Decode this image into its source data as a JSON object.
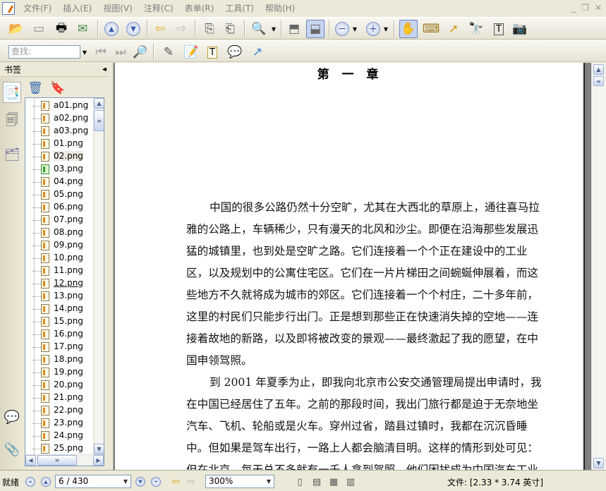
{
  "menu": {
    "items": [
      "文件(F)",
      "插入(E)",
      "视图(V)",
      "注释(C)",
      "表单(R)",
      "工具(T)",
      "帮助(H)"
    ]
  },
  "search": {
    "placeholder": "查找:"
  },
  "sidebar": {
    "title": "书签",
    "collapse_glyph": "◂◂",
    "items": [
      "a01.png",
      "a02.png",
      "a03.png",
      "01.png",
      "02.png",
      "03.png",
      "04.png",
      "05.png",
      "06.png",
      "07.png",
      "08.png",
      "09.png",
      "10.png",
      "11.png",
      "12.png",
      "13.png",
      "14.png",
      "15.png",
      "16.png",
      "17.png",
      "18.png",
      "19.png",
      "20.png",
      "21.png",
      "22.png",
      "23.png",
      "24.png",
      "25.png"
    ]
  },
  "document": {
    "chapter_title": "第 一 章",
    "lines": [
      "中国的很多公路仍然十分空旷，尤其在大西北的草原上，通往喜马拉",
      "雅的公路上，车辆稀少，只有漫天的北风和沙尘。即便在沿海那些发展迅",
      "猛的城镇里，也到处是空旷之路。它们连接着一个个正在建设中的工业",
      "区，以及规划中的公寓住宅区。它们在一片片梯田之间蜿蜒伸展着，而这",
      "些地方不久就将成为城市的郊区。它们连接着一个个村庄，二十多年前，",
      "这里的村民们只能步行出门。正是想到那些正在快速消失掉的空地——连",
      "接着故地的新路，以及即将被改变的景观——最终激起了我的愿望，在中",
      "国申领驾照。",
      "到 2001 年夏季为止，即我向北京市公安交通管理局提出申请时，我",
      "在中国已经居住了五年。之前的那段时间，我出门旅行都是迫于无奈地坐",
      "汽车、飞机、轮船或是火车。穿州过省，踏县过镇时，我都在沉沉昏睡",
      "中。但如果是驾车出行，一路上人都会脑清目明。这样的情形到处可见：",
      "但在北京，每天总不多就有一千人拿到驾照。他们困扰成为中国汽车工业"
    ]
  },
  "status": {
    "ready": "就绪",
    "page": "6 / 430",
    "zoom": "300%",
    "file_size": "文件: [2.33 * 3.74 英寸]"
  }
}
